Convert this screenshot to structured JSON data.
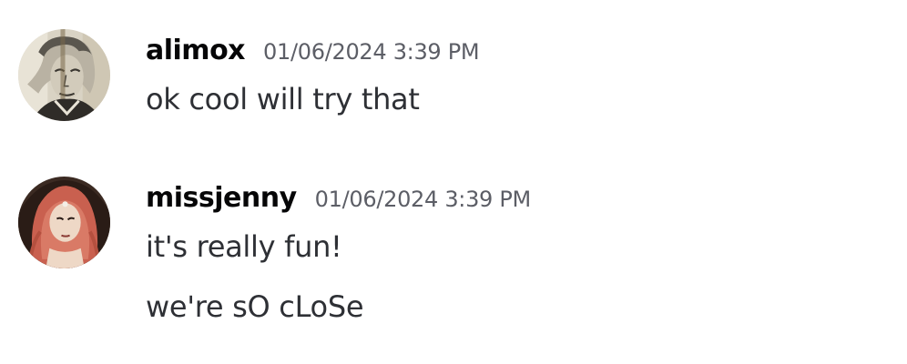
{
  "messages": [
    {
      "username": "alimox",
      "timestamp": "01/06/2024 3:39 PM",
      "avatar_icon": "sketch-portrait-avatar",
      "lines": [
        "ok cool will try that"
      ]
    },
    {
      "username": "missjenny",
      "timestamp": "01/06/2024 3:39 PM",
      "avatar_icon": "red-haired-illustration-avatar",
      "lines": [
        "it's really fun!",
        "we're sO cLoSe"
      ]
    }
  ]
}
